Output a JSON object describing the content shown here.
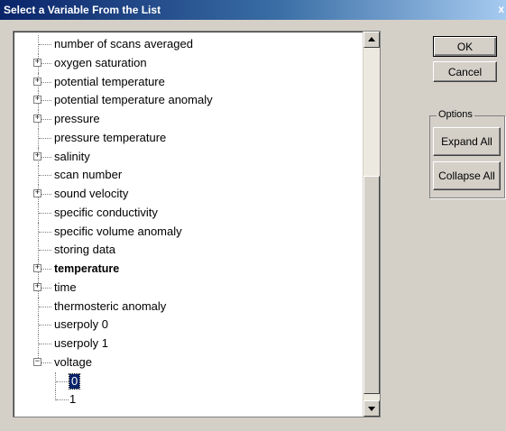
{
  "window": {
    "title": "Select a Variable From the List",
    "close_glyph": "x"
  },
  "tree": {
    "items": [
      {
        "label": "number of scans averaged",
        "expandable": false
      },
      {
        "label": "oxygen saturation",
        "expandable": true
      },
      {
        "label": "potential temperature",
        "expandable": true
      },
      {
        "label": "potential temperature anomaly",
        "expandable": true
      },
      {
        "label": "pressure",
        "expandable": true
      },
      {
        "label": "pressure temperature",
        "expandable": false
      },
      {
        "label": "salinity",
        "expandable": true
      },
      {
        "label": "scan number",
        "expandable": false
      },
      {
        "label": "sound velocity",
        "expandable": true
      },
      {
        "label": "specific conductivity",
        "expandable": false
      },
      {
        "label": "specific volume anomaly",
        "expandable": false
      },
      {
        "label": "storing data",
        "expandable": false
      },
      {
        "label": "temperature",
        "expandable": true,
        "bold": true
      },
      {
        "label": "time",
        "expandable": true
      },
      {
        "label": "thermosteric anomaly",
        "expandable": false
      },
      {
        "label": "userpoly 0",
        "expandable": false
      },
      {
        "label": "userpoly 1",
        "expandable": false
      },
      {
        "label": "voltage",
        "expandable": true,
        "expanded": true
      }
    ],
    "children": [
      {
        "label": "0",
        "selected": true
      },
      {
        "label": "1",
        "selected": false
      }
    ],
    "expand_glyph": "+",
    "collapse_glyph": "−"
  },
  "buttons": {
    "ok": "OK",
    "cancel": "Cancel",
    "expand_all": "Expand All",
    "collapse_all": "Collapse All"
  },
  "options": {
    "legend": "Options"
  },
  "colors": {
    "title_start": "#0a246a",
    "title_end": "#a6caf0",
    "selection": "#0a246a",
    "face": "#d4d0c8"
  }
}
